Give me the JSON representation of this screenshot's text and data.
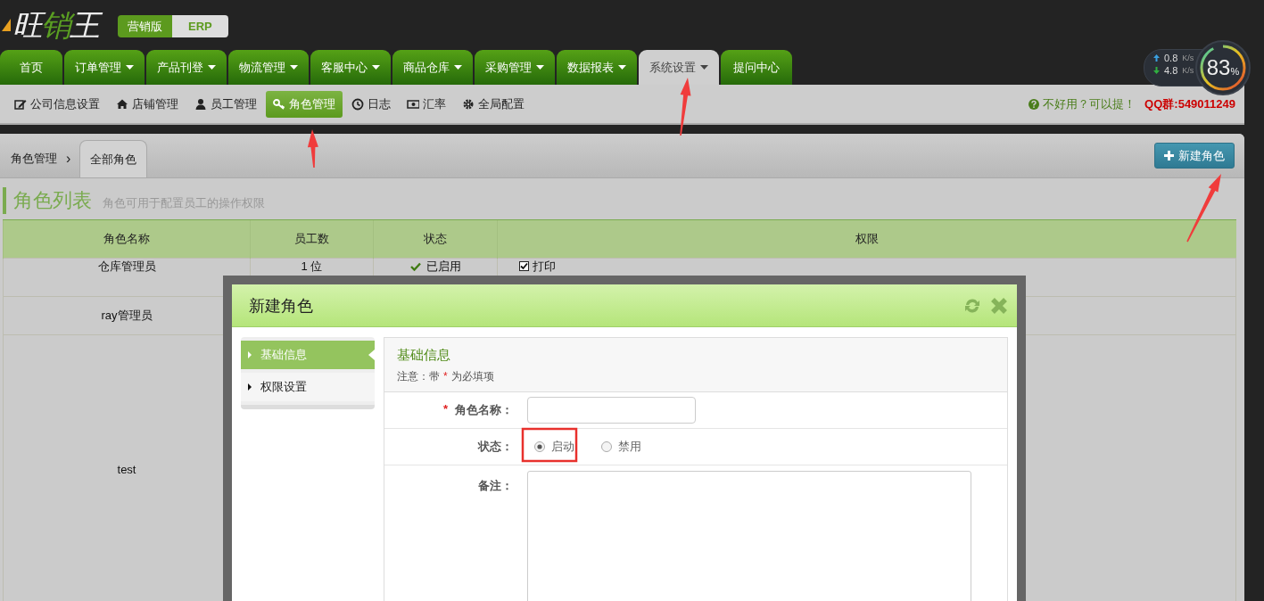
{
  "header": {
    "logo": "旺销王",
    "edition": [
      {
        "label": "营销版",
        "selected": true
      },
      {
        "label": "ERP",
        "selected": false
      }
    ]
  },
  "nav_tabs": [
    {
      "label": "首页",
      "dropdown": false,
      "selected": false
    },
    {
      "label": "订单管理",
      "dropdown": true,
      "selected": false
    },
    {
      "label": "产品刊登",
      "dropdown": true,
      "selected": false
    },
    {
      "label": "物流管理",
      "dropdown": true,
      "selected": false
    },
    {
      "label": "客服中心",
      "dropdown": true,
      "selected": false
    },
    {
      "label": "商品仓库",
      "dropdown": true,
      "selected": false
    },
    {
      "label": "采购管理",
      "dropdown": true,
      "selected": false
    },
    {
      "label": "数据报表",
      "dropdown": true,
      "selected": false
    },
    {
      "label": "系统设置",
      "dropdown": true,
      "selected": true
    },
    {
      "label": "提问中心",
      "dropdown": false,
      "selected": false
    }
  ],
  "subnav": [
    {
      "label": "公司信息设置",
      "selected": false
    },
    {
      "label": "店铺管理",
      "selected": false
    },
    {
      "label": "员工管理",
      "selected": false
    },
    {
      "label": "角色管理",
      "selected": true
    },
    {
      "label": "日志",
      "selected": false
    },
    {
      "label": "汇率",
      "selected": false
    },
    {
      "label": "全局配置",
      "selected": false
    }
  ],
  "feedback": {
    "text": "不好用？可以提！",
    "qq": "QQ群:549011249"
  },
  "net_widget": {
    "speeds": [
      {
        "value": "0.8",
        "unit": "K/s"
      },
      {
        "value": "4.8",
        "unit": "K/s"
      }
    ],
    "percent": "83",
    "percent_sign": "%"
  },
  "breadcrumb": {
    "parent": "角色管理",
    "separator": "›",
    "tabs": [
      {
        "label": "全部角色",
        "selected": true
      }
    ]
  },
  "new_button": "新建角色",
  "section": {
    "title": "角色列表",
    "subtitle": "角色可用于配置员工的操作权限"
  },
  "table": {
    "columns": [
      "角色名称",
      "员工数",
      "状态",
      "权限"
    ],
    "rows": [
      {
        "name": "仓库管理员",
        "count": "1 位",
        "status": "已启用",
        "permissions": [
          {
            "label": "打印",
            "checked": true
          }
        ]
      },
      {
        "name": "ray管理员"
      },
      {
        "name": "test"
      }
    ]
  },
  "modal": {
    "title": "新建角色",
    "menu": [
      {
        "label": "基础信息",
        "selected": true
      },
      {
        "label": "权限设置",
        "selected": false
      }
    ],
    "panel_title": "基础信息",
    "note": {
      "before": "注意：带",
      "mark": "*",
      "after": "为必填项"
    },
    "fields": [
      {
        "kind": "text",
        "label": "角色名称：",
        "required": true
      },
      {
        "kind": "radio",
        "label": "状态：",
        "required": false,
        "options": [
          {
            "label": "启动",
            "selected": true
          },
          {
            "label": "禁用",
            "selected": false
          }
        ]
      },
      {
        "kind": "textarea",
        "label": "备注：",
        "required": false
      }
    ]
  }
}
